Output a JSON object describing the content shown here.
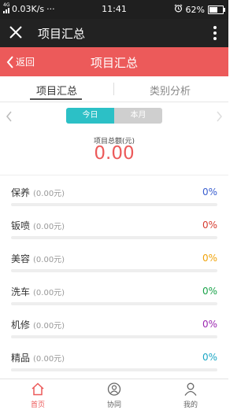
{
  "statusbar": {
    "signal": "4G",
    "speed": "0.03K/s",
    "dots": "···",
    "time": "11:41",
    "battery_pct": "62%",
    "battery_level": 0.62
  },
  "titlebar": {
    "title": "项目汇总",
    "close_icon": "close-icon",
    "more_icon": "more-icon"
  },
  "header": {
    "back_label": "返回",
    "title": "项目汇总"
  },
  "tabs": [
    {
      "label": "项目汇总"
    },
    {
      "label": "类别分析"
    }
  ],
  "segment": {
    "today": "今日",
    "month": "本月"
  },
  "total": {
    "label": "项目总额(元)",
    "value": "0.00"
  },
  "items": [
    {
      "name": "保养",
      "amount": "(0.00元)",
      "percent": "0%",
      "color": "#3a5fd0"
    },
    {
      "name": "钣喷",
      "amount": "(0.00元)",
      "percent": "0%",
      "color": "#d63b2f"
    },
    {
      "name": "美容",
      "amount": "(0.00元)",
      "percent": "0%",
      "color": "#f0a30a"
    },
    {
      "name": "洗车",
      "amount": "(0.00元)",
      "percent": "0%",
      "color": "#1aa34a"
    },
    {
      "name": "机修",
      "amount": "(0.00元)",
      "percent": "0%",
      "color": "#9b27b0"
    },
    {
      "name": "精品",
      "amount": "(0.00元)",
      "percent": "0%",
      "color": "#1aa6c4"
    }
  ],
  "nav": [
    {
      "label": "首页"
    },
    {
      "label": "协同"
    },
    {
      "label": "我的"
    }
  ],
  "colors": {
    "accent": "#ec5a5a",
    "segment_active": "#2cc0c6"
  }
}
